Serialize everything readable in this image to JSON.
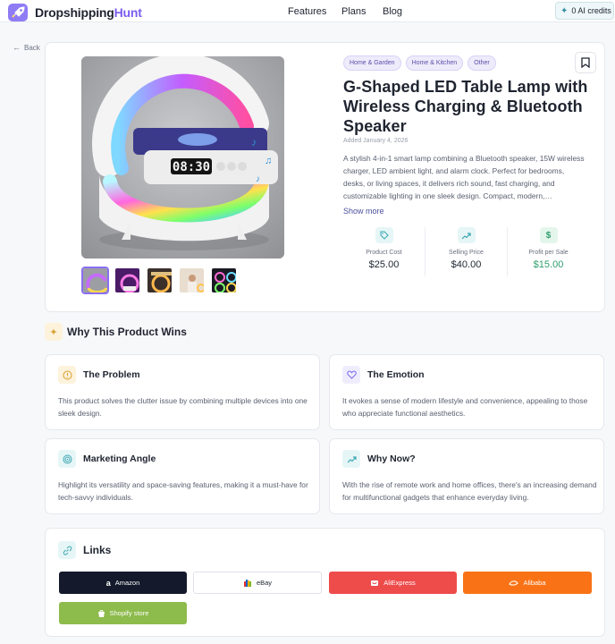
{
  "header": {
    "brand_main": "Dropshipping",
    "brand_accent": "Hunt",
    "nav": [
      "Features",
      "Plans",
      "Blog"
    ],
    "credits": "0 AI credits"
  },
  "back_label": "Back",
  "product": {
    "tags": [
      "Home & Garden",
      "Home & Kitchen",
      "Other"
    ],
    "title": "G-Shaped LED Table Lamp with Wireless Charging & Bluetooth Speaker",
    "added": "Added January 4, 2026",
    "description": "A stylish 4-in-1 smart lamp combining a Bluetooth speaker, 15W wireless charger, LED ambient light, and alarm clock. Perfect for bedrooms, desks, or living spaces, it delivers rich sound, fast charging, and customizable lighting in one sleek design. Compact, modern,…",
    "show_more": "Show more",
    "clock": "08:30",
    "stats": [
      {
        "label": "Product Cost",
        "value": "$25.00",
        "icon": "tag-icon",
        "color": "#3aa6b0",
        "bg": "#e6f6f7",
        "value_color": "#1f2430"
      },
      {
        "label": "Selling Price",
        "value": "$40.00",
        "icon": "trend-up-icon",
        "color": "#3aa6b0",
        "bg": "#e6f6f7",
        "value_color": "#1f2430"
      },
      {
        "label": "Profit per Sale",
        "value": "$15.00",
        "icon": "dollar-icon",
        "color": "#2f9e6e",
        "bg": "#e4f6ec",
        "value_color": "#2f9e6e"
      }
    ]
  },
  "why": {
    "title": "Why This Product Wins",
    "cards": [
      {
        "title": "The Problem",
        "text": "This product solves the clutter issue by combining multiple devices into one sleek design.",
        "icon": "alert-icon",
        "color": "#d89a2a",
        "bg": "#fdf3dc"
      },
      {
        "title": "The Emotion",
        "text": "It evokes a sense of modern lifestyle and convenience, appealing to those who appreciate functional aesthetics.",
        "icon": "heart-icon",
        "color": "#7b6cf0",
        "bg": "#efedfd"
      },
      {
        "title": "Marketing Angle",
        "text": "Highlight its versatility and space-saving features, making it a must-have for tech-savvy individuals.",
        "icon": "target-icon",
        "color": "#3aa6b0",
        "bg": "#e6f6f7"
      },
      {
        "title": "Why Now?",
        "text": "With the rise of remote work and home offices, there's an increasing demand for multifunctional gadgets that enhance everyday living.",
        "icon": "trend-up-icon",
        "color": "#3aa6b0",
        "bg": "#e6f6f7"
      }
    ]
  },
  "links": {
    "title": "Links",
    "buttons": [
      {
        "label": "Amazon",
        "bg": "#141a2b",
        "fg": "#ffffff",
        "icon": "amazon-icon"
      },
      {
        "label": "eBay",
        "bg": "#ffffff",
        "fg": "#1f2430",
        "icon": "ebay-icon"
      },
      {
        "label": "AliExpress",
        "bg": "#ee4b4b",
        "fg": "#ffffff",
        "icon": "aliexpress-icon"
      },
      {
        "label": "Alibaba",
        "bg": "#f97316",
        "fg": "#ffffff",
        "icon": "alibaba-icon"
      },
      {
        "label": "Shopify store",
        "bg": "#8dbb4c",
        "fg": "#ffffff",
        "icon": "shopify-icon"
      }
    ]
  }
}
